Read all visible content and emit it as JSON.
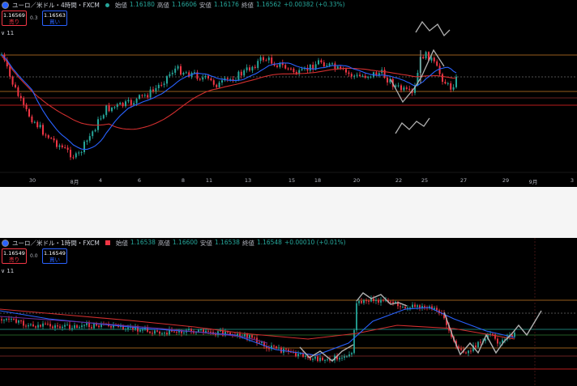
{
  "colors": {
    "up": "#26a69a",
    "down": "#f23645",
    "ma_fast": "#2962ff",
    "ma_slow": "#d32f2f",
    "orange": "#c87b25",
    "drawing": "#b0b0b0",
    "purple": "#9c27b0"
  },
  "panel1": {
    "title": "ユーロ／米ドル・4時間・FXCM",
    "ohlc": [
      {
        "k": "始値",
        "v": "1.16180"
      },
      {
        "k": "高値",
        "v": "1.16606"
      },
      {
        "k": "安値",
        "v": "1.16176"
      },
      {
        "k": "終値",
        "v": "1.16562"
      },
      {
        "k": "",
        "v": "+0.00382 (+0.33%)"
      }
    ],
    "sell": {
      "price": "1.16569",
      "label": "売り"
    },
    "buy": {
      "price": "1.16563",
      "label": "買い"
    },
    "spread": "0.3",
    "collapse_label": "∨ 11",
    "x_ticks": [
      "30",
      "8月",
      "4",
      "6",
      "8",
      "11",
      "13",
      "15",
      "18",
      "20",
      "22",
      "25",
      "27",
      "29",
      "9月",
      "3"
    ]
  },
  "panel2": {
    "title": "ユーロ／米ドル・1時間・FXCM",
    "ohlc": [
      {
        "k": "始値",
        "v": "1.16538"
      },
      {
        "k": "高値",
        "v": "1.16600"
      },
      {
        "k": "安値",
        "v": "1.16538"
      },
      {
        "k": "終値",
        "v": "1.16548"
      },
      {
        "k": "",
        "v": "+0.00010 (+0.01%)"
      }
    ],
    "sell": {
      "price": "1.16549",
      "label": "売り"
    },
    "buy": {
      "price": "1.16549",
      "label": "買い"
    },
    "spread": "0.0",
    "collapse_label": "∨ 11"
  },
  "chart_data": [
    {
      "type": "candlestick",
      "title": "ユーロ／米ドル・4時間・FXCM",
      "x_ticks": [
        "30",
        "8月",
        "4",
        "6",
        "8",
        "11",
        "13",
        "15",
        "18",
        "20",
        "22",
        "25",
        "27",
        "29",
        "9月",
        "3"
      ],
      "seed": 7,
      "series": [
        {
          "name": "",
          "kind": "moving-average"
        },
        {
          "name": "",
          "kind": "moving-average"
        }
      ]
    },
    {
      "type": "candlestick",
      "title": "ユーロ／米ドル・1時間・FXCM",
      "seed": 13,
      "series": [
        {
          "name": "",
          "kind": "moving-average"
        },
        {
          "name": "",
          "kind": "moving-average"
        }
      ]
    }
  ]
}
